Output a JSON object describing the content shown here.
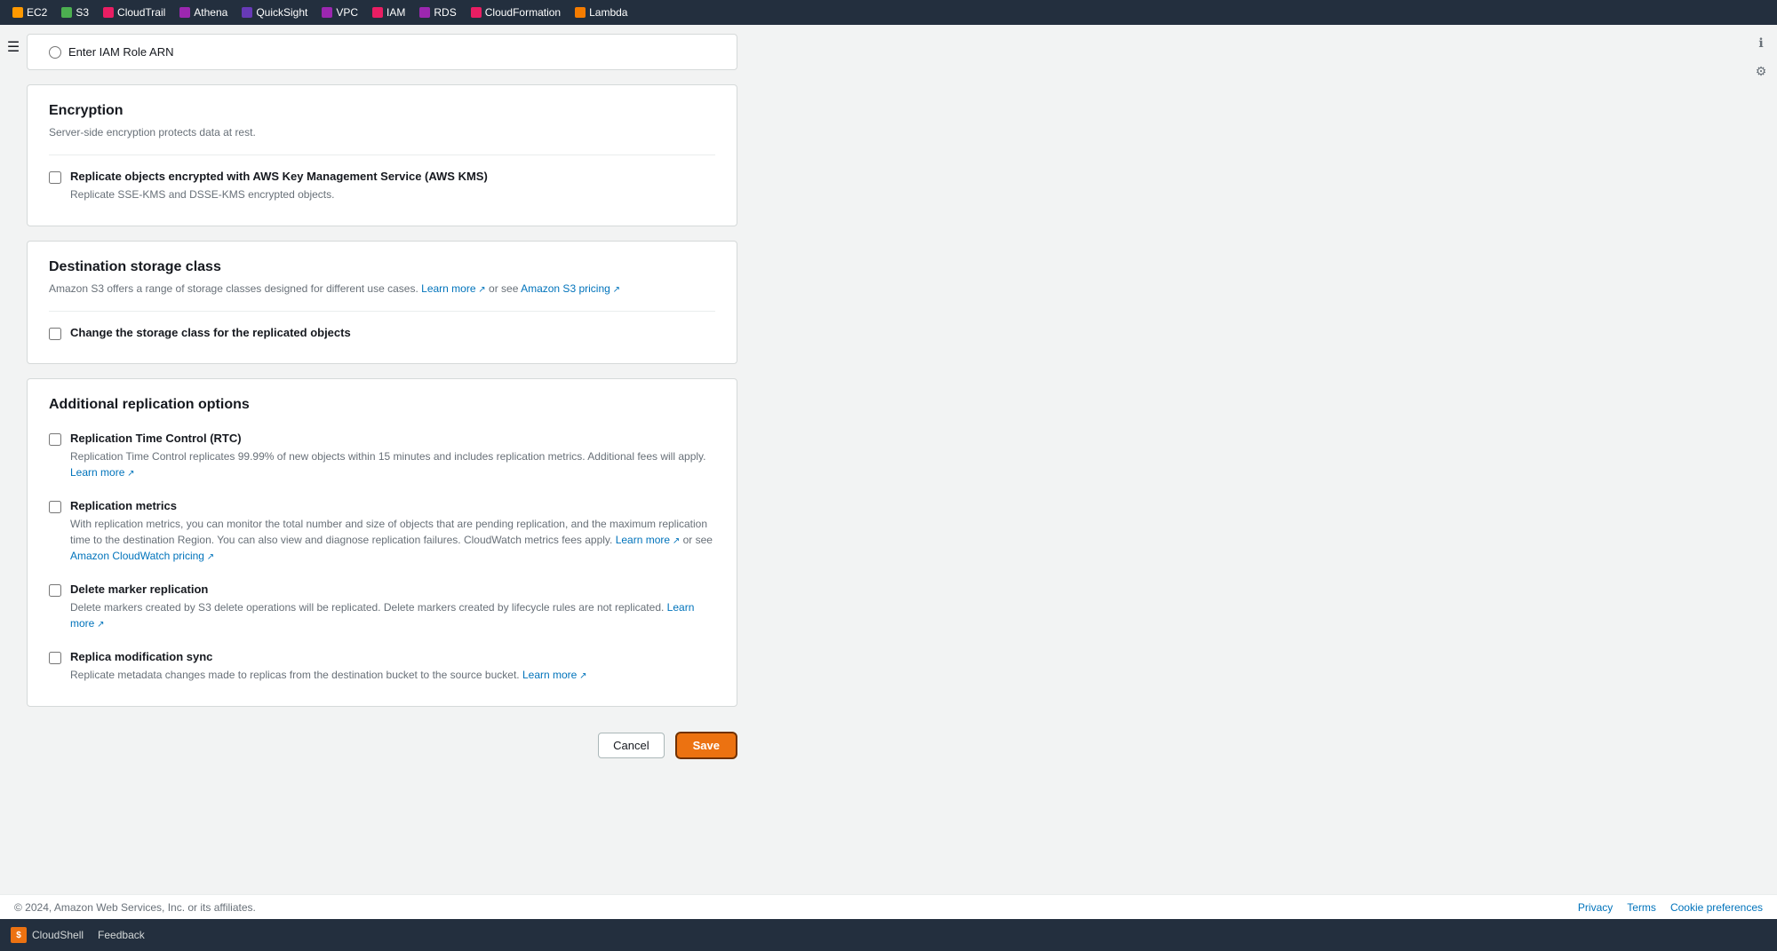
{
  "nav": {
    "services": [
      {
        "id": "ec2",
        "label": "EC2",
        "color": "#f90"
      },
      {
        "id": "s3",
        "label": "S3",
        "color": "#4caf50"
      },
      {
        "id": "cloudtrail",
        "label": "CloudTrail",
        "color": "#e91e63"
      },
      {
        "id": "athena",
        "label": "Athena",
        "color": "#9c27b0"
      },
      {
        "id": "quicksight",
        "label": "QuickSight",
        "color": "#673ab7"
      },
      {
        "id": "vpc",
        "label": "VPC",
        "color": "#9c27b0"
      },
      {
        "id": "iam",
        "label": "IAM",
        "color": "#e91e63"
      },
      {
        "id": "rds",
        "label": "RDS",
        "color": "#9c27b0"
      },
      {
        "id": "cloudformation",
        "label": "CloudFormation",
        "color": "#e91e63"
      },
      {
        "id": "lambda",
        "label": "Lambda",
        "color": "#f57c00"
      }
    ]
  },
  "partial_section": {
    "radio_label": "Enter IAM Role ARN"
  },
  "encryption": {
    "title": "Encryption",
    "description": "Server-side encryption protects data at rest.",
    "checkbox_label": "Replicate objects encrypted with AWS Key Management Service (AWS KMS)",
    "checkbox_sub": "Replicate SSE-KMS and DSSE-KMS encrypted objects.",
    "checked": false
  },
  "destination_storage": {
    "title": "Destination storage class",
    "description": "Amazon S3 offers a range of storage classes designed for different use cases.",
    "learn_more_link": "Learn more",
    "or_see_text": "or see",
    "pricing_link": "Amazon S3 pricing",
    "checkbox_label": "Change the storage class for the replicated objects",
    "checked": false
  },
  "additional_options": {
    "title": "Additional replication options",
    "options": [
      {
        "id": "rtc",
        "label": "Replication Time Control (RTC)",
        "description": "Replication Time Control replicates 99.99% of new objects within 15 minutes and includes replication metrics. Additional fees will apply.",
        "learn_more": "Learn more",
        "checked": false
      },
      {
        "id": "metrics",
        "label": "Replication metrics",
        "description": "With replication metrics, you can monitor the total number and size of objects that are pending replication, and the maximum replication time to the destination Region. You can also view and diagnose replication failures. CloudWatch metrics fees apply.",
        "learn_more": "Learn more",
        "or_see": "or see",
        "pricing_link": "Amazon CloudWatch pricing",
        "checked": false
      },
      {
        "id": "delete-marker",
        "label": "Delete marker replication",
        "description": "Delete markers created by S3 delete operations will be replicated. Delete markers created by lifecycle rules are not replicated.",
        "learn_more": "Learn more",
        "checked": false
      },
      {
        "id": "replica-sync",
        "label": "Replica modification sync",
        "description": "Replicate metadata changes made to replicas from the destination bucket to the source bucket.",
        "learn_more": "Learn more",
        "checked": false
      }
    ]
  },
  "actions": {
    "cancel_label": "Cancel",
    "save_label": "Save"
  },
  "footer": {
    "copyright": "© 2024, Amazon Web Services, Inc. or its affiliates.",
    "privacy_label": "Privacy",
    "terms_label": "Terms",
    "cookie_label": "Cookie preferences",
    "feedback_label": "Feedback",
    "cloudshell_label": "CloudShell"
  }
}
